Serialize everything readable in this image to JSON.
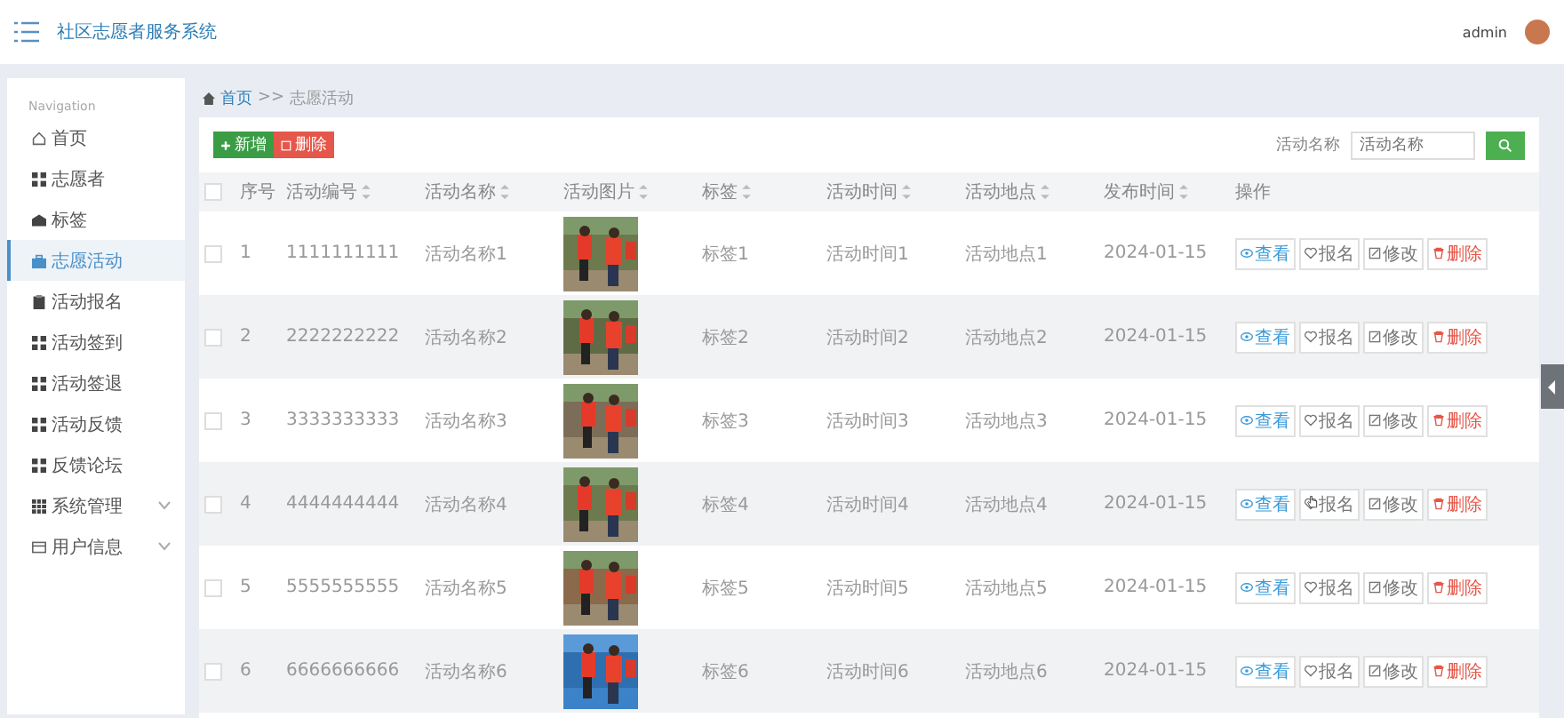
{
  "header": {
    "title": "社区志愿者服务系统",
    "user": "admin"
  },
  "sidebar": {
    "heading": "Navigation",
    "items": [
      {
        "label": "首页",
        "selected": false
      },
      {
        "label": "志愿者",
        "selected": false
      },
      {
        "label": "标签",
        "selected": false
      },
      {
        "label": "志愿活动",
        "selected": true
      },
      {
        "label": "活动报名",
        "selected": false
      },
      {
        "label": "活动签到",
        "selected": false
      },
      {
        "label": "活动签退",
        "selected": false
      },
      {
        "label": "活动反馈",
        "selected": false
      },
      {
        "label": "反馈论坛",
        "selected": false
      },
      {
        "label": "系统管理",
        "selected": false,
        "expanded": false
      },
      {
        "label": "用户信息",
        "selected": false,
        "expanded": false
      }
    ]
  },
  "breadcrumb": [
    {
      "label": "首页",
      "kind": "link"
    },
    {
      "label": ">>",
      "kind": "separator"
    },
    {
      "label": "志愿活动",
      "kind": "current"
    }
  ],
  "toolbar": {
    "buttons": [
      {
        "kind": "add",
        "label": "新增"
      },
      {
        "kind": "delete",
        "label": "删除"
      }
    ],
    "search": {
      "label": "活动名称",
      "placeholder": "活动名称"
    }
  },
  "table": {
    "columns": [
      {
        "kind": "checkbox",
        "checked": false
      },
      {
        "kind": "text",
        "label": "序号",
        "sortable": false
      },
      {
        "kind": "text",
        "label": "活动编号",
        "sortable": true
      },
      {
        "kind": "text",
        "label": "活动名称",
        "sortable": true
      },
      {
        "kind": "text",
        "label": "活动图片",
        "sortable": true
      },
      {
        "kind": "text",
        "label": "标签",
        "sortable": true
      },
      {
        "kind": "text",
        "label": "活动时间",
        "sortable": true
      },
      {
        "kind": "text",
        "label": "活动地点",
        "sortable": true
      },
      {
        "kind": "text",
        "label": "发布时间",
        "sortable": true
      },
      {
        "kind": "text",
        "label": "操作",
        "sortable": false
      }
    ],
    "rows": [
      {
        "cells": [
          {
            "kind": "checkbox",
            "checked": false
          },
          "1",
          "1111111111",
          "活动名称1",
          {
            "kind": "picture"
          },
          "标签1",
          "活动时间1",
          "活动地点1",
          "2024-01-15",
          {
            "kind": "actions",
            "buttons": [
              {
                "kind": "view",
                "label": "查看",
                "hovered": false
              },
              {
                "kind": "signup",
                "label": "报名",
                "hovered": false
              },
              {
                "kind": "edit",
                "label": "修改",
                "hovered": false
              },
              {
                "kind": "delete",
                "label": "删除",
                "hovered": false
              }
            ]
          }
        ]
      },
      {
        "cells": [
          {
            "kind": "checkbox",
            "checked": false
          },
          "2",
          "2222222222",
          "活动名称2",
          {
            "kind": "picture"
          },
          "标签2",
          "活动时间2",
          "活动地点2",
          "2024-01-15",
          {
            "kind": "actions",
            "buttons": [
              {
                "kind": "view",
                "label": "查看",
                "hovered": false
              },
              {
                "kind": "signup",
                "label": "报名",
                "hovered": false
              },
              {
                "kind": "edit",
                "label": "修改",
                "hovered": false
              },
              {
                "kind": "delete",
                "label": "删除",
                "hovered": false
              }
            ]
          }
        ]
      },
      {
        "cells": [
          {
            "kind": "checkbox",
            "checked": false
          },
          "3",
          "3333333333",
          "活动名称3",
          {
            "kind": "picture"
          },
          "标签3",
          "活动时间3",
          "活动地点3",
          "2024-01-15",
          {
            "kind": "actions",
            "buttons": [
              {
                "kind": "view",
                "label": "查看",
                "hovered": false
              },
              {
                "kind": "signup",
                "label": "报名",
                "hovered": false
              },
              {
                "kind": "edit",
                "label": "修改",
                "hovered": false
              },
              {
                "kind": "delete",
                "label": "删除",
                "hovered": false
              }
            ]
          }
        ]
      },
      {
        "cells": [
          {
            "kind": "checkbox",
            "checked": false
          },
          "4",
          "4444444444",
          "活动名称4",
          {
            "kind": "picture"
          },
          "标签4",
          "活动时间4",
          "活动地点4",
          "2024-01-15",
          {
            "kind": "actions",
            "buttons": [
              {
                "kind": "view",
                "label": "查看",
                "hovered": false
              },
              {
                "kind": "signup",
                "label": "报名",
                "hovered": true
              },
              {
                "kind": "edit",
                "label": "修改",
                "hovered": false
              },
              {
                "kind": "delete",
                "label": "删除",
                "hovered": false
              }
            ]
          }
        ]
      },
      {
        "cells": [
          {
            "kind": "checkbox",
            "checked": false
          },
          "5",
          "5555555555",
          "活动名称5",
          {
            "kind": "picture"
          },
          "标签5",
          "活动时间5",
          "活动地点5",
          "2024-01-15",
          {
            "kind": "actions",
            "buttons": [
              {
                "kind": "view",
                "label": "查看",
                "hovered": false
              },
              {
                "kind": "signup",
                "label": "报名",
                "hovered": false
              },
              {
                "kind": "edit",
                "label": "修改",
                "hovered": false
              },
              {
                "kind": "delete",
                "label": "删除",
                "hovered": false
              }
            ]
          }
        ]
      },
      {
        "cells": [
          {
            "kind": "checkbox",
            "checked": false
          },
          "6",
          "6666666666",
          "活动名称6",
          {
            "kind": "picture"
          },
          "标签6",
          "活动时间6",
          "活动地点6",
          "2024-01-15",
          {
            "kind": "actions",
            "buttons": [
              {
                "kind": "view",
                "label": "查看",
                "hovered": false
              },
              {
                "kind": "signup",
                "label": "报名",
                "hovered": false
              },
              {
                "kind": "edit",
                "label": "修改",
                "hovered": false
              },
              {
                "kind": "delete",
                "label": "删除",
                "hovered": false
              }
            ]
          }
        ]
      }
    ]
  }
}
